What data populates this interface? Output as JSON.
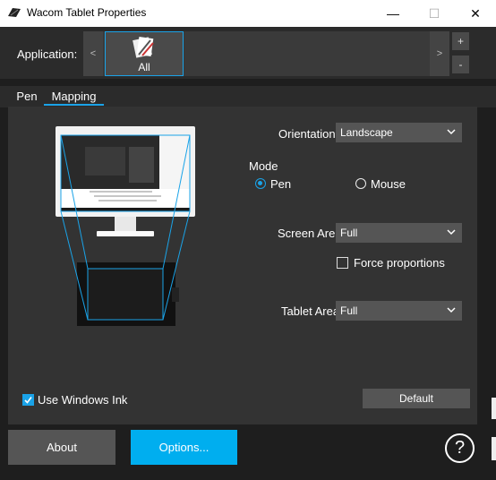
{
  "window": {
    "title": "Wacom Tablet Properties",
    "controls": {
      "minimize": "—",
      "maximize": "☐",
      "close": "✕"
    }
  },
  "application_bar": {
    "label": "Application:",
    "prev_arrow": "<",
    "next_arrow": ">",
    "selected_app": "All",
    "add_button": "+",
    "remove_button": "-"
  },
  "tabs": [
    {
      "label": "Pen"
    },
    {
      "label": "Mapping"
    }
  ],
  "mapping": {
    "orientation": {
      "label": "Orientation:",
      "value": "Landscape"
    },
    "mode": {
      "label": "Mode",
      "options": [
        {
          "label": "Pen"
        },
        {
          "label": "Mouse"
        }
      ],
      "selected": "Pen"
    },
    "screen_area": {
      "label": "Screen Area:",
      "value": "Full"
    },
    "force_proportions": {
      "label": "Force proportions",
      "checked": false
    },
    "tablet_area": {
      "label": "Tablet Area:",
      "value": "Full"
    },
    "use_windows_ink": {
      "label": "Use Windows Ink",
      "checked": true
    },
    "default_button": "Default"
  },
  "footer": {
    "about": "About",
    "options": "Options...",
    "help": "?"
  },
  "colors": {
    "accent": "#1aa3e8",
    "options_button": "#00aeef",
    "panel": "#333333",
    "background": "#1e1e1e"
  }
}
